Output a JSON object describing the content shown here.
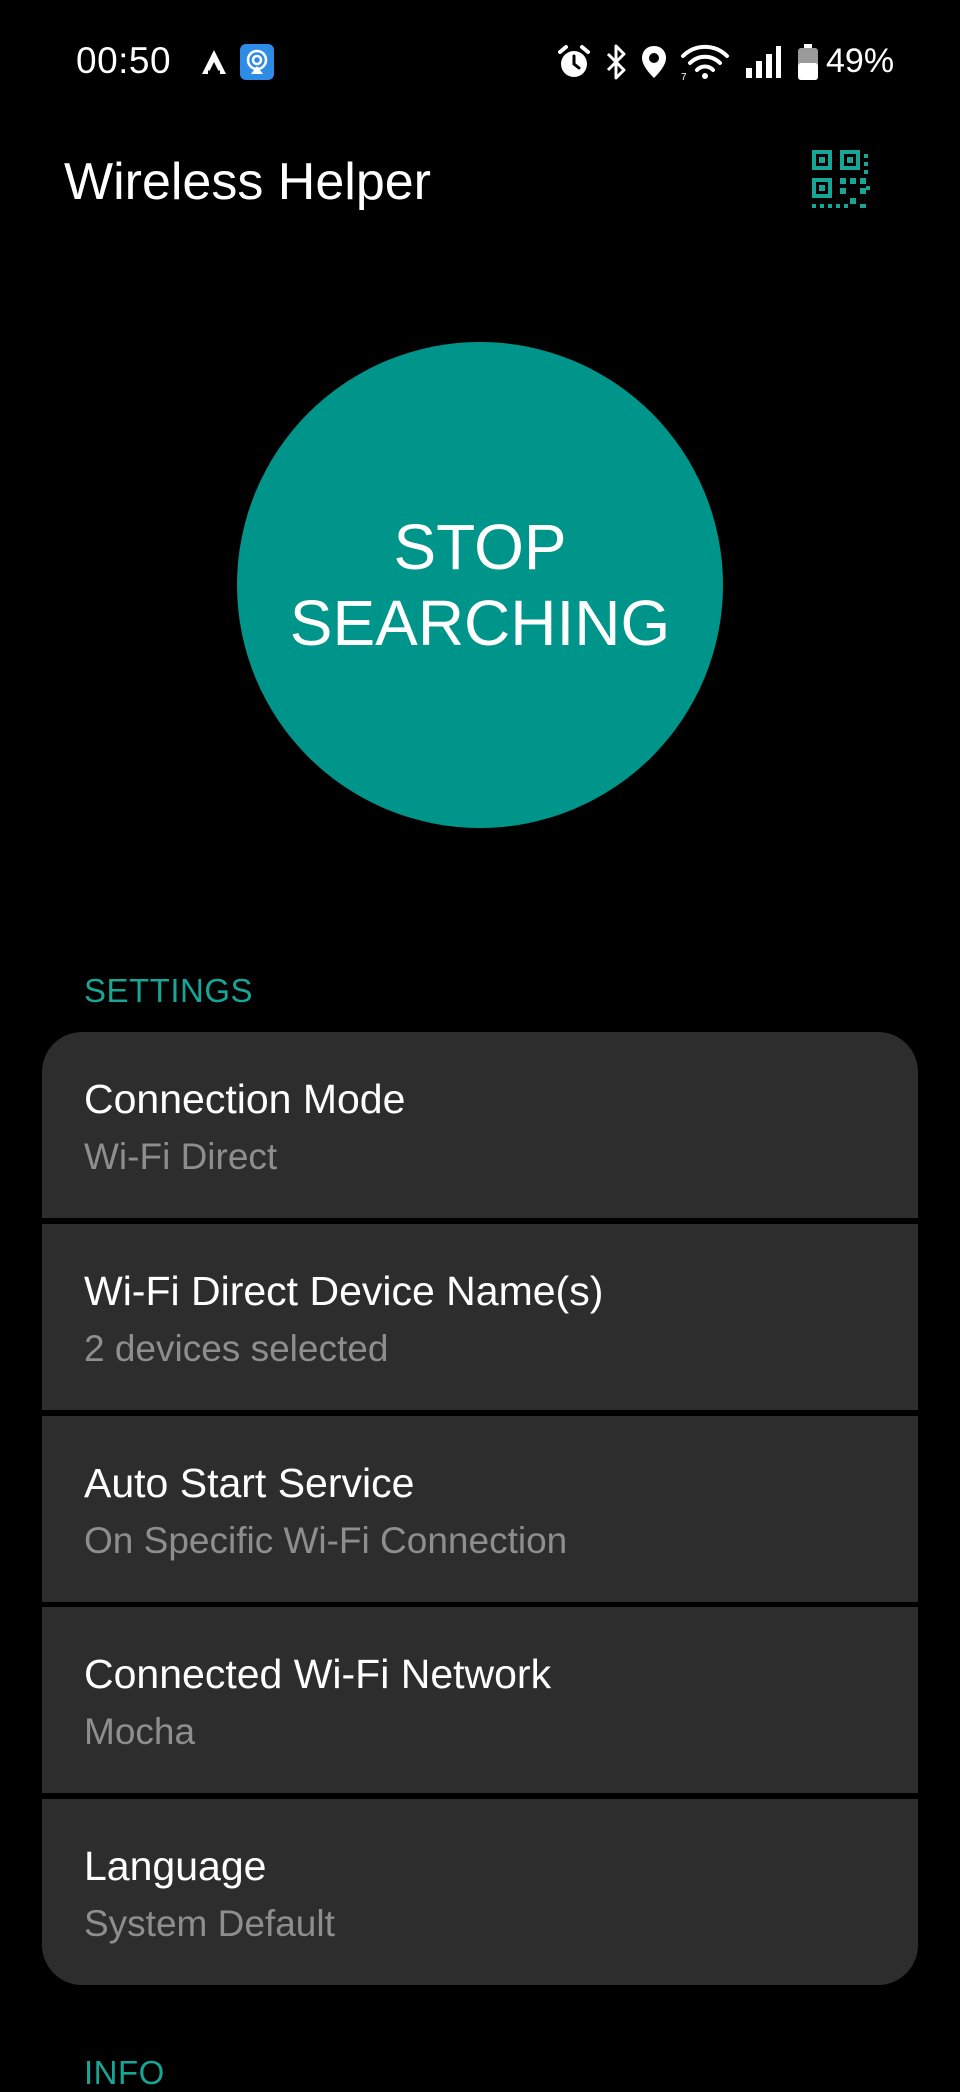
{
  "status_bar": {
    "time": "00:50",
    "battery": "49%",
    "icons": [
      "android-auto-icon",
      "cast-app-icon",
      "alarm-icon",
      "bluetooth-icon",
      "location-icon",
      "wifi-icon",
      "signal-icon",
      "battery-icon"
    ]
  },
  "app_bar": {
    "title": "Wireless Helper",
    "qr_icon": "qr-code-icon"
  },
  "main_button": {
    "label": "STOP\nSEARCHING",
    "color": "#00958a"
  },
  "settings": {
    "header": "SETTINGS",
    "items": [
      {
        "title": "Connection Mode",
        "subtitle": "Wi-Fi Direct"
      },
      {
        "title": "Wi-Fi Direct Device Name(s)",
        "subtitle": "2 devices selected"
      },
      {
        "title": "Auto Start Service",
        "subtitle": "On Specific Wi-Fi Connection"
      },
      {
        "title": "Connected Wi-Fi Network",
        "subtitle": "Mocha"
      },
      {
        "title": "Language",
        "subtitle": "System Default"
      }
    ]
  },
  "info": {
    "header": "INFO"
  },
  "colors": {
    "accent": "#17a596",
    "card": "#2d2d2d",
    "secondary_text": "#8e8e8e",
    "background": "#000000"
  }
}
